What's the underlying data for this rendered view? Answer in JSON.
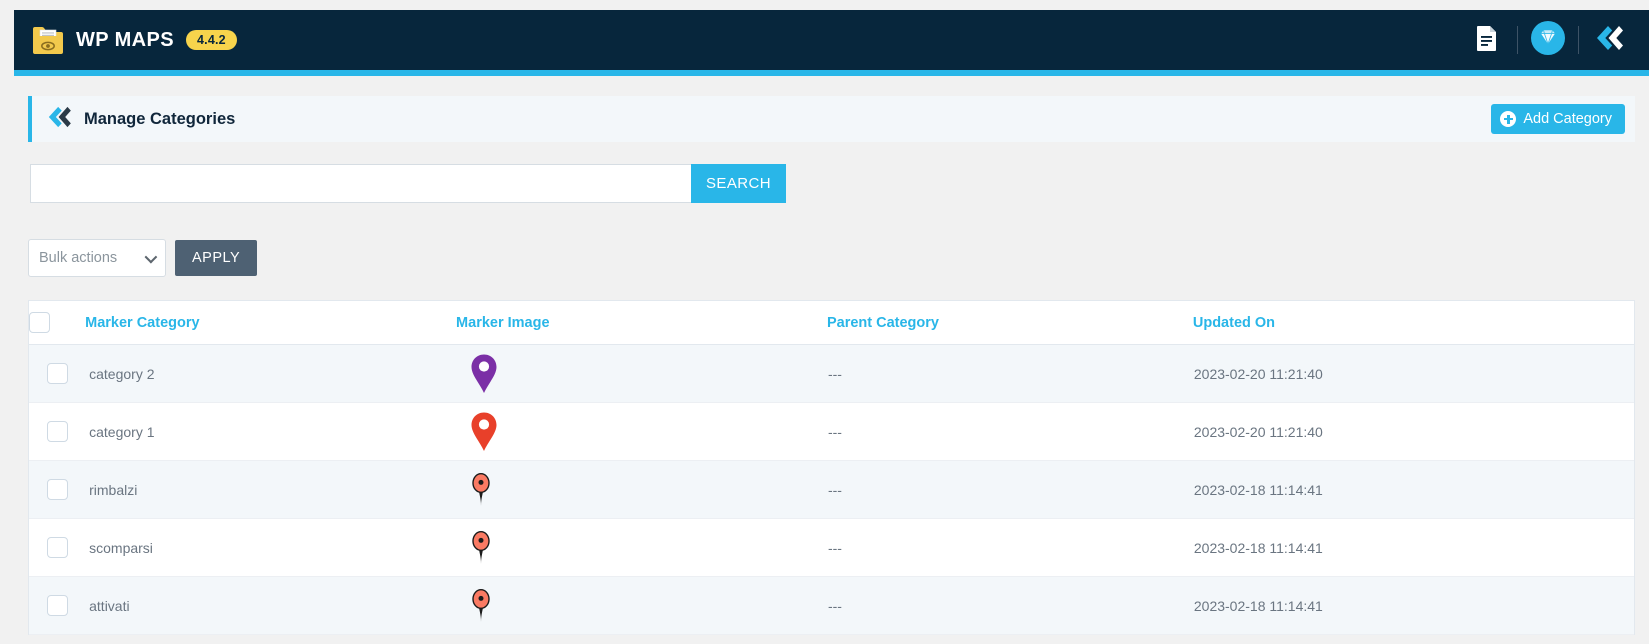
{
  "topbar": {
    "brand_title": "WP MAPS",
    "version_badge": "4.4.2",
    "folder_icon": "folder-document-eye-icon",
    "doc_icon": "document-icon",
    "gem_icon": "diamond-gem-icon",
    "logo_icon": "double-chevron-left-icon",
    "bar_color": "#07263c",
    "accent_color": "#29b6e8",
    "badge_color": "#f7d44c"
  },
  "panel": {
    "logo_icon": "double-chevron-left-icon",
    "title": "Manage Categories",
    "add_button_label": "Add Category",
    "add_button_icon": "plus-circle-icon",
    "accent_color": "#29b6e8"
  },
  "search": {
    "value": "",
    "placeholder": "",
    "button_label": "SEARCH"
  },
  "bulk": {
    "select_value": "Bulk actions",
    "apply_label": "APPLY",
    "chevron_icon": "chevron-down-icon",
    "apply_color": "#4e6173"
  },
  "table": {
    "select_all_checkbox": "unchecked",
    "columns": [
      "Marker Category",
      "Marker Image",
      "Parent Category",
      "Updated On"
    ],
    "rows": [
      {
        "checkbox": "unchecked",
        "category": "category 2",
        "marker_icon": "map-pin-purple-ring-icon",
        "marker_color": "#7b2fa6",
        "parent": "---",
        "updated": "2023-02-20 11:21:40"
      },
      {
        "checkbox": "unchecked",
        "category": "category 1",
        "marker_icon": "map-pin-red-ring-icon",
        "marker_color": "#e8402a",
        "parent": "---",
        "updated": "2023-02-20 11:21:40"
      },
      {
        "checkbox": "unchecked",
        "category": "rimbalzi",
        "marker_icon": "map-pin-salmon-dot-icon",
        "marker_color": "#fa7a63",
        "parent": "---",
        "updated": "2023-02-18 11:14:41"
      },
      {
        "checkbox": "unchecked",
        "category": "scomparsi",
        "marker_icon": "map-pin-salmon-dot-icon",
        "marker_color": "#fa7a63",
        "parent": "---",
        "updated": "2023-02-18 11:14:41"
      },
      {
        "checkbox": "unchecked",
        "category": "attivati",
        "marker_icon": "map-pin-salmon-dot-icon",
        "marker_color": "#fa7a63",
        "parent": "---",
        "updated": "2023-02-18 11:14:41"
      }
    ]
  }
}
